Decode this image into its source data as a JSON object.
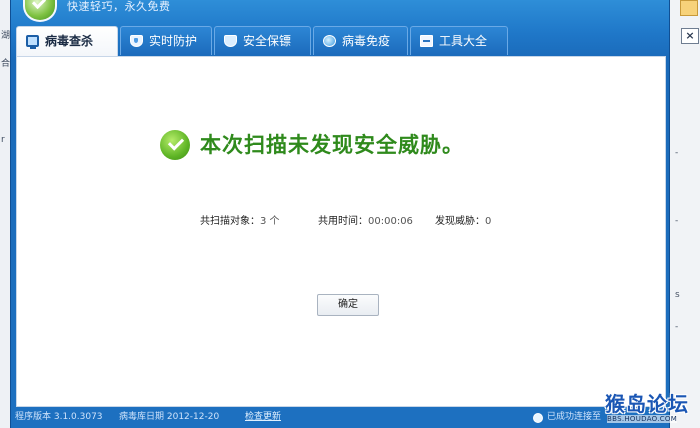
{
  "header": {
    "slogan": "快速轻巧，永久免费"
  },
  "tabs": [
    {
      "label": "病毒查杀",
      "icon": "monitor-icon",
      "active": true
    },
    {
      "label": "实时防护",
      "icon": "shield-icon",
      "active": false
    },
    {
      "label": "安全保镖",
      "icon": "shield-icon",
      "active": false
    },
    {
      "label": "病毒免疫",
      "icon": "globe-icon",
      "active": false
    },
    {
      "label": "工具大全",
      "icon": "toolbox-icon",
      "active": false
    }
  ],
  "result": {
    "message": "本次扫描未发现安全威胁。",
    "icon": "check-circle-icon",
    "color": "#2f8a1c"
  },
  "stats": {
    "scanned_label": "共扫描对象：",
    "scanned_value": "3 个",
    "time_label": "共用时间：",
    "time_value": "00:00:06",
    "threats_label": "发现威胁：",
    "threats_value": "0"
  },
  "buttons": {
    "ok_label": "确定"
  },
  "status_bar": {
    "version": "程序版本 3.1.0.3073",
    "virus_db": "病毒库日期 2012-12-20",
    "check_update": "检查更新",
    "connection": "已成功连接至"
  },
  "watermark": {
    "title": "猴岛论坛",
    "url": "BBS.HOUDAO.COM"
  },
  "colors": {
    "window_blue": "#1d70c0",
    "success_green": "#2f8a1c"
  }
}
